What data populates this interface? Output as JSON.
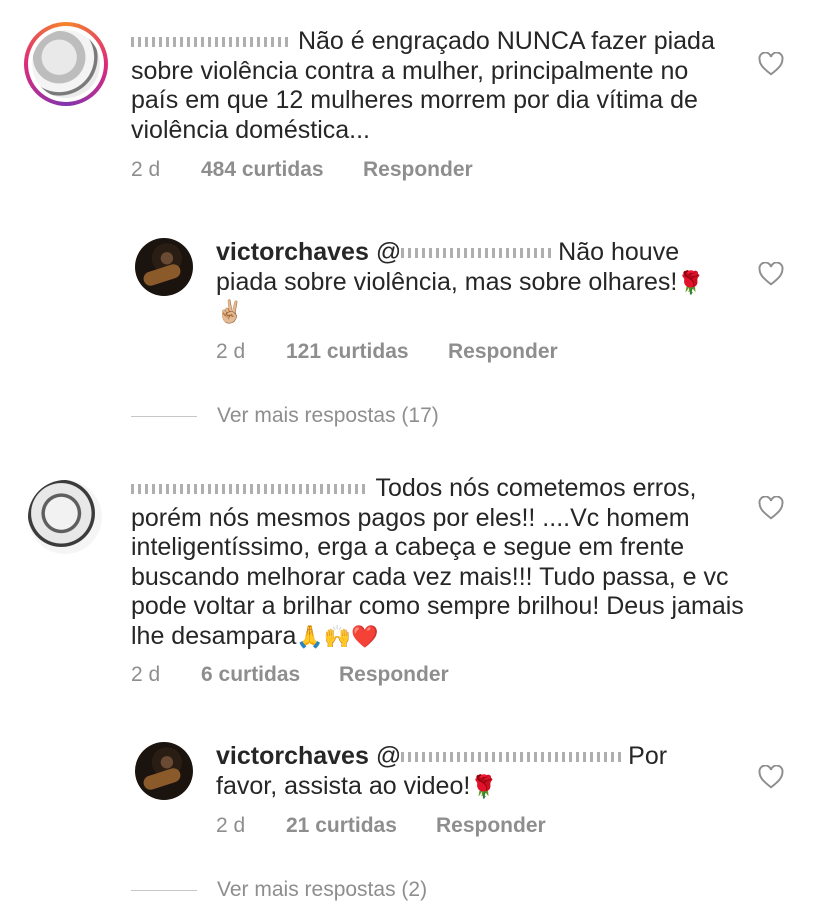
{
  "comments": [
    {
      "text": "Não é engraçado NUNCA fazer piada sobre violência contra a mulher, principalmente no país em que 12 mulheres morrem por dia vítima de violência doméstica...",
      "time": "2 d",
      "likes": "484 curtidas",
      "reply": "Responder",
      "icon": "heart-outline-icon"
    },
    {
      "username": "victorchaves",
      "mention": "@",
      "text_line1": "Não houve",
      "text_line2": "piada sobre violência, mas sobre olhares!",
      "emoji_rose": "🌹",
      "emoji_peace": "✌🏼",
      "time": "2 d",
      "likes": "121 curtidas",
      "reply": "Responder",
      "more_replies": "Ver mais respostas (17)"
    },
    {
      "text_line1": "Todos nós cometemos erros,",
      "text_rest": "porém nós mesmos pagos por eles!! ....Vc homem inteligentíssimo, erga a cabeça e segue em frente buscando melhorar cada vez mais!!! Tudo passa, e vc pode voltar a brilhar como sempre brilhou! Deus jamais lhe desampara",
      "emoji_end": "🙏🙌❤️",
      "time": "2 d",
      "likes": "6 curtidas",
      "reply": "Responder"
    },
    {
      "username": "victorchaves",
      "mention": "@",
      "text_line1": "Por",
      "text_line2": "favor, assista ao video!",
      "emoji_rose": "🌹",
      "time": "2 d",
      "likes": "21 curtidas",
      "reply": "Responder",
      "more_replies": "Ver mais respostas (2)"
    }
  ]
}
